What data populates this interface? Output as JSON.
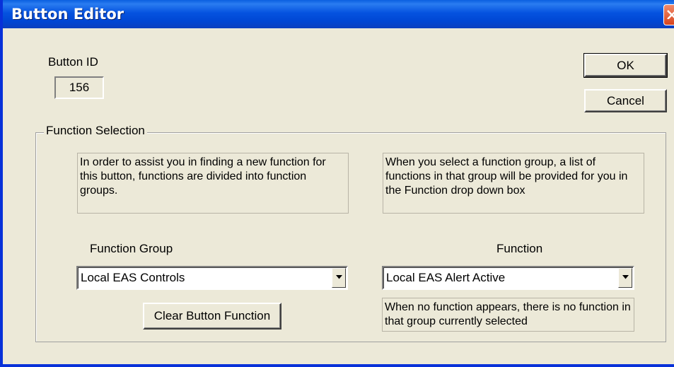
{
  "window": {
    "title": "Button Editor"
  },
  "button_id": {
    "label": "Button ID",
    "value": "156"
  },
  "actions": {
    "ok_label": "OK",
    "cancel_label": "Cancel"
  },
  "function_selection": {
    "legend": "Function Selection",
    "left_info": "In order to assist you in finding a new function for this button, functions are divided into function groups.",
    "right_info": "When you select a function group, a list of functions in that group will be provided for you in the Function drop down box",
    "group_label": "Function Group",
    "group_value": "Local EAS Controls",
    "function_label": "Function",
    "function_value": "Local EAS Alert Active",
    "clear_button_label": "Clear Button Function",
    "no_function_note": "When no function appears, there is no function in that group currently selected"
  },
  "colors": {
    "titlebar": "#0553e0",
    "face": "#ece9d8",
    "close": "#d8451e"
  },
  "icons": {
    "close": "close-icon",
    "dropdown": "chevron-down-icon"
  }
}
